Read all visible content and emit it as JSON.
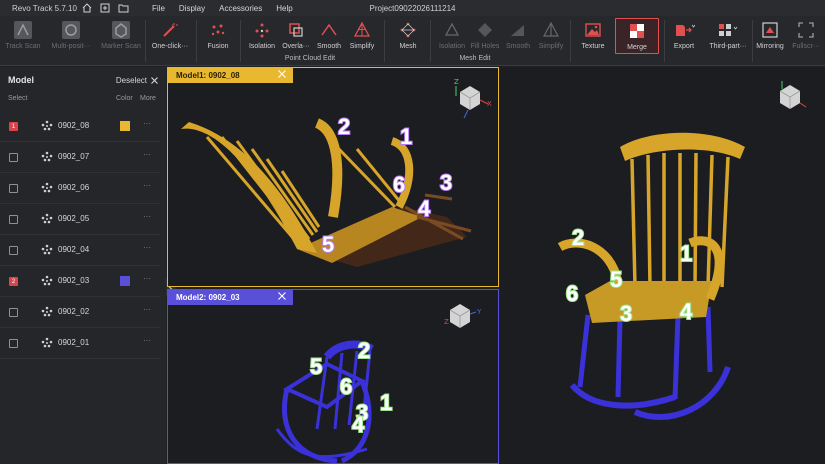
{
  "app": {
    "title": "Revo Track 5.7.10",
    "project": "Project09022026111214",
    "menu": [
      "File",
      "Display",
      "Accessories",
      "Help"
    ]
  },
  "toolbar": {
    "track_scan": "Track Scan",
    "multi_position": "Multi-posit···",
    "marker_scan": "Marker Scan",
    "one_click": "One-click···",
    "fusion": "Fusion",
    "isolation": "Isolation",
    "overlap": "Overla···",
    "smooth": "Smooth",
    "simplify": "Simplify",
    "mesh": "Mesh",
    "mesh_isolation": "Isolation",
    "fill_holes": "Fill Holes",
    "mesh_smooth": "Smooth",
    "mesh_simplify": "Simplify",
    "texture": "Texture",
    "merge": "Merge",
    "export": "Export",
    "third_party": "Third-part···",
    "mirroring": "Mirroring",
    "fullscreen": "Fullscr···",
    "group_point_cloud": "Point Cloud Edit",
    "group_mesh": "Mesh Edit"
  },
  "panel": {
    "title": "Model",
    "deselect": "Deselect",
    "col_select": "Select",
    "col_color": "Color",
    "col_more": "More",
    "more_glyph": "···",
    "models": [
      {
        "name": "0902_08",
        "checked": true,
        "index": "1",
        "color": "#e8b830"
      },
      {
        "name": "0902_07",
        "checked": false,
        "index": "",
        "color": ""
      },
      {
        "name": "0902_06",
        "checked": false,
        "index": "",
        "color": ""
      },
      {
        "name": "0902_05",
        "checked": false,
        "index": "",
        "color": ""
      },
      {
        "name": "0902_04",
        "checked": false,
        "index": "",
        "color": ""
      },
      {
        "name": "0902_03",
        "checked": true,
        "index": "2",
        "color": "#5a4fd8"
      },
      {
        "name": "0902_02",
        "checked": false,
        "index": "",
        "color": ""
      },
      {
        "name": "0902_01",
        "checked": false,
        "index": "",
        "color": ""
      }
    ]
  },
  "viewports": {
    "vp1_title": "Model1: 0902_08",
    "vp2_title": "Model2: 0902_03"
  },
  "markers": {
    "vp1": [
      "1",
      "2",
      "3",
      "4",
      "5",
      "6"
    ],
    "vp2": [
      "1",
      "2",
      "3",
      "4",
      "5",
      "6"
    ],
    "vp3": [
      "1",
      "2",
      "3",
      "4",
      "5",
      "6"
    ]
  },
  "colors": {
    "accent_yellow": "#e8b830",
    "accent_blue": "#5a4fd8",
    "marker_purple": "#b57cf0",
    "marker_green": "#9be38a",
    "chair_gold": "#d7a52a",
    "chair_blue": "#3b31d9"
  }
}
